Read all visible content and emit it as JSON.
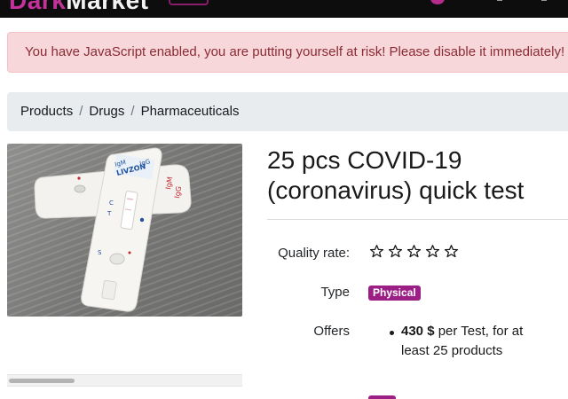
{
  "brand": {
    "part1": "Dark",
    "part2": "Market"
  },
  "alert": {
    "message": "You have JavaScript enabled, you are putting yourself at risk! Please disable it immediately!"
  },
  "breadcrumb": [
    "Products",
    "Drugs",
    "Pharmaceuticals"
  ],
  "breadcrumb_separator": "/",
  "product": {
    "title_line1": "25 pcs COVID-19",
    "title_line2": "(coronavirus) quick test",
    "quality_label": "Quality rate:",
    "quality_rating": 0,
    "quality_max": 5,
    "type_label": "Type",
    "type_value": "Physical",
    "offers_label": "Offers",
    "offer_price": "430 $",
    "offer_rest_line1": "per Test, for at",
    "offer_rest_line2": "least 25 products"
  },
  "photo": {
    "cassette_back": {
      "label_a": "IgM",
      "label_b": "IgG"
    },
    "cassette_front": {
      "label_top": "IgM",
      "label_top2": "IgG",
      "brand": "LIVZON",
      "mark_c": "C",
      "mark_t": "T",
      "mark_s": "S"
    }
  },
  "colors": {
    "accent": "#9c1f86",
    "alert_bg": "#f8d7da",
    "alert_text": "#8a2b33",
    "breadcrumb_bg": "#e9ecef"
  },
  "icons": {
    "star": "star-outline-icon"
  }
}
